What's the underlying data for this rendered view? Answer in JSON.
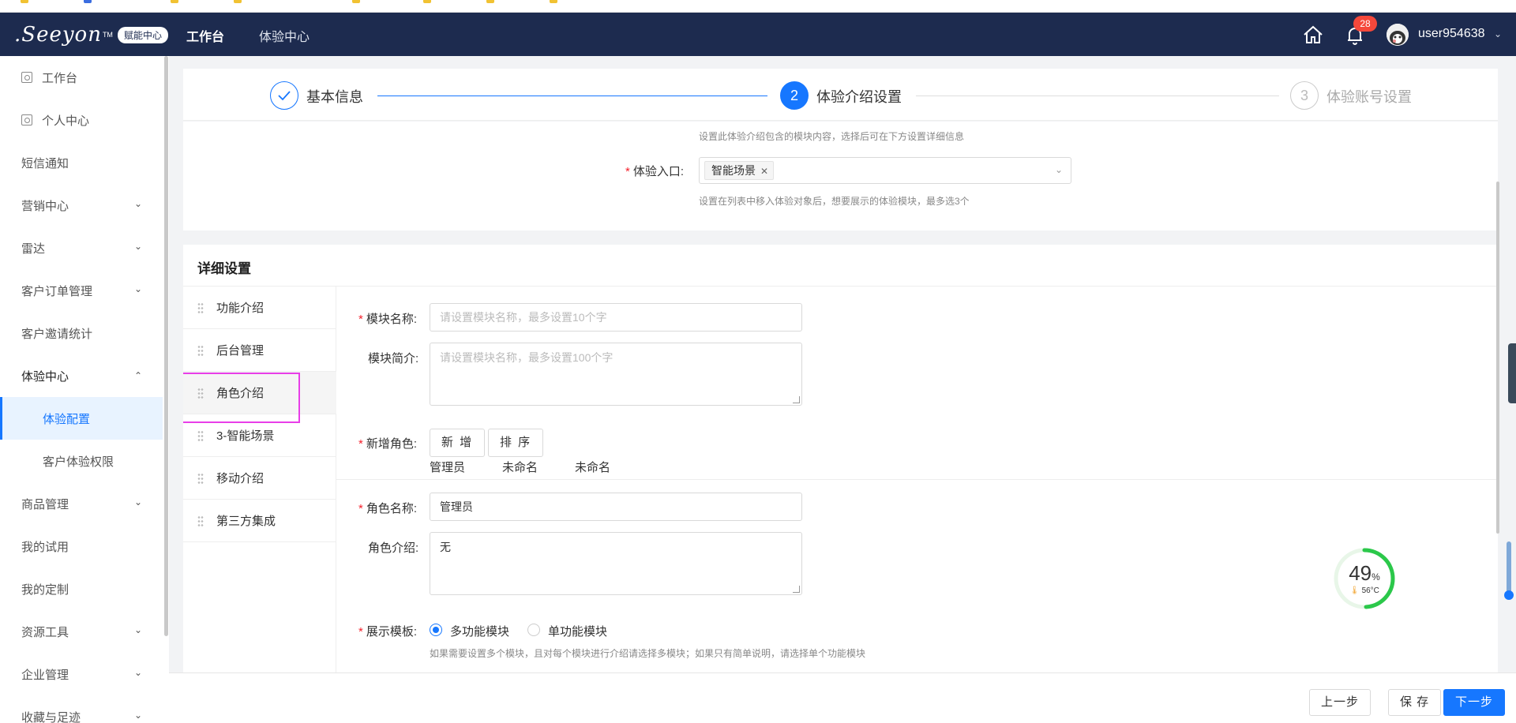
{
  "header": {
    "logo_text": ".Seeyon",
    "logo_tm": "TM",
    "logo_badge": "赋能中心",
    "nav": [
      "工作台",
      "体验中心"
    ],
    "notification_count": "28",
    "username": "user954638"
  },
  "sidebar": {
    "items": [
      {
        "label": "工作台"
      },
      {
        "label": "个人中心"
      },
      {
        "label": "短信通知"
      },
      {
        "label": "营销中心"
      },
      {
        "label": "雷达"
      },
      {
        "label": "客户订单管理"
      },
      {
        "label": "客户邀请统计"
      },
      {
        "label": "体验中心"
      },
      {
        "label": "体验配置"
      },
      {
        "label": "客户体验权限"
      },
      {
        "label": "商品管理"
      },
      {
        "label": "我的试用"
      },
      {
        "label": "我的定制"
      },
      {
        "label": "资源工具"
      },
      {
        "label": "企业管理"
      },
      {
        "label": "收藏与足迹"
      }
    ]
  },
  "steps": [
    {
      "number": "1",
      "label": "基本信息",
      "state": "done"
    },
    {
      "number": "2",
      "label": "体验介绍设置",
      "state": "active"
    },
    {
      "number": "3",
      "label": "体验账号设置",
      "state": "pending"
    }
  ],
  "intro": {
    "module_hint": "设置此体验介绍包含的模块内容，选择后可在下方设置详细信息",
    "entry_label": "体验入口:",
    "entry_tag": "智能场景",
    "entry_hint": "设置在列表中移入体验对象后，想要展示的体验模块，最多选3个"
  },
  "detail": {
    "title": "详细设置",
    "modules": [
      "功能介绍",
      "后台管理",
      "角色介绍",
      "3-智能场景",
      "移动介绍",
      "第三方集成"
    ],
    "selected_module": "角色介绍",
    "module_name_label": "模块名称:",
    "module_name_placeholder": "请设置模块名称，最多设置10个字",
    "module_intro_label": "模块简介:",
    "module_intro_placeholder": "请设置模块名称，最多设置100个字",
    "add_role_label": "新增角色:",
    "add_button": "新 增",
    "sort_button": "排 序",
    "roles": [
      "管理员",
      "未命名",
      "未命名"
    ],
    "role_name_label": "角色名称:",
    "role_name_value": "管理员",
    "role_intro_label": "角色介绍:",
    "role_intro_value": "无",
    "template_label": "展示模板:",
    "template_options": [
      "多功能模块",
      "单功能模块"
    ],
    "template_selected": "多功能模块",
    "template_hint": "如果需要设置多个模块，且对每个模块进行介绍请选择多模块；如果只有简单说明，请选择单个功能模块"
  },
  "gauge": {
    "value": "49",
    "unit": "%",
    "temp": "56°C",
    "percent": 49
  },
  "footer": {
    "prev": "上一步",
    "save": "保 存",
    "next": "下一步"
  },
  "colors": {
    "header_bg": "#1d2b4f",
    "accent": "#1677ff",
    "highlight": "#e83ee8"
  }
}
